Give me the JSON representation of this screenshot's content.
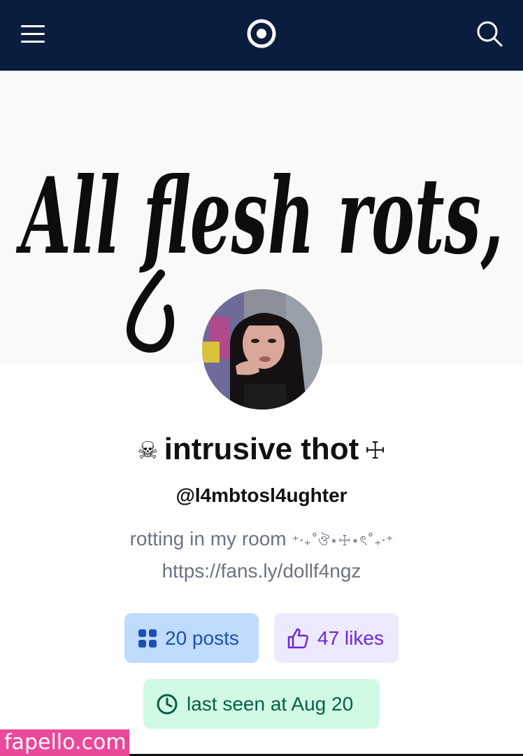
{
  "header": {
    "menu_icon": "hamburger-menu-icon",
    "logo_icon": "ring-logo-icon",
    "search_icon": "search-icon",
    "background": "#0b1d3f"
  },
  "banner": {
    "text": "All flesh rots,"
  },
  "profile": {
    "skull": "☠",
    "name": "intrusive thot",
    "cross": "☩",
    "handle": "@l4mbtosl4ughter",
    "bio_text": "rotting in my room",
    "bio_deco": "⁺‧₊˚ঔ⋆☩⋆ৎ˚₊‧⁺",
    "bio_link": "https://fans.ly/dollf4ngz"
  },
  "stats": {
    "posts": "20 posts",
    "likes": "47 likes",
    "last_seen": "last seen at Aug 20"
  },
  "watermark": "fapello.com"
}
